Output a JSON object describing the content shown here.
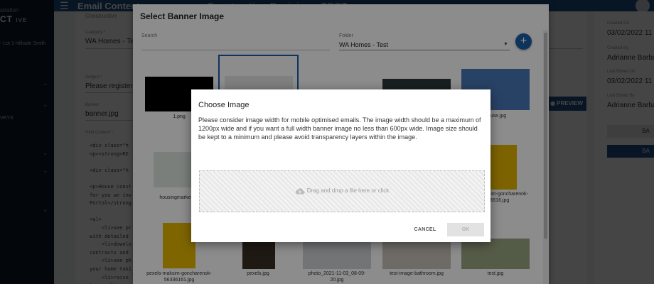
{
  "background": {
    "sidebar": {
      "brand_top": "stration",
      "brand_main": "CT",
      "brand_sub": "IVE",
      "project": "- Lot 1 Hillside Smith",
      "nav_fragment": "VEYS"
    },
    "topbar": {
      "title": "Email Content",
      "title_faded": "Constructive  Revision - TEST"
    },
    "form": {
      "top_fragment": "Constructive",
      "category_label": "Category *",
      "category_value": "WA Homes - Test",
      "subject_label": "Subject *",
      "subject_value": "Please register fo",
      "banner_label": "Banner",
      "banner_value": "banner.jpg",
      "html_label": "Html Content *",
      "preview_label": "PREVIEW",
      "code_lines": [
        "<div class=\"h",
        "<p><strong>RE",
        "",
        "<div class=\"h",
        "",
        "<p>House const",
        "for you we inv",
        "Portal</strong",
        "",
        "<ul>",
        "    <li>see pr",
        "with detailed",
        "    <li>downlo",
        "contracts and",
        "    <li>see ph",
        "your home taki",
        "    <li>raise",
        "team;</li>",
        "    <li>read t"
      ]
    },
    "right_panel": {
      "created_on_label": "Created On",
      "created_on_value": "03/02/2022 11",
      "created_by_label": "Created By",
      "created_by_value": "Adrianne Barba",
      "last_edited_on_label": "Last Edited On",
      "last_edited_on_value": "03/02/2022 11",
      "last_edited_by_label": "Last Edited By",
      "last_edited_by_value": "Adrianne Barba",
      "btn1_fragment": "BA",
      "btn2_fragment": "BA"
    }
  },
  "banner_dialog": {
    "title": "Select Banner Image",
    "search_label": "Search",
    "folder_label": "Folder",
    "folder_value": "WA Homes - Test",
    "add_symbol": "+",
    "images": [
      {
        "caption": "1.png",
        "color": "#000000"
      },
      {
        "caption": "",
        "color": "#e8e8e8"
      },
      {
        "caption": "",
        "color": "#2d3a3a"
      },
      {
        "caption": "house.jpg",
        "color": "#4a78b8"
      },
      {
        "caption": "housingmarket su",
        "color": "#dfe8e2"
      },
      {
        "caption": "pexels-maksim-goncharenok-5636616.jpg",
        "color": "#e4b200"
      },
      {
        "caption": "pexels-maksim-goncharenok-56336161.jpg",
        "color": "#e8b800"
      },
      {
        "caption": "pexels.jpg",
        "color": "#3a2e26"
      },
      {
        "caption": "photo_2021-11-03_08-09-20.jpg",
        "color": "#cfd3d6"
      },
      {
        "caption": "test-image-bathroom.jpg",
        "color": "#c9c2b8"
      },
      {
        "caption": "test.jpg",
        "color": "#9aa884"
      }
    ]
  },
  "choose_dialog": {
    "title": "Choose Image",
    "text": "Please consider image width for mobile optimised emails. The image width should be a maximum of 1200px wide and if you want a full width banner image no less than 600px wide. Image size should be kept to a minimum and please avoid transparency layers within the image.",
    "dropzone_text": "Drag and drop a file here or click",
    "cancel_label": "CANCEL",
    "ok_label": "OK"
  }
}
